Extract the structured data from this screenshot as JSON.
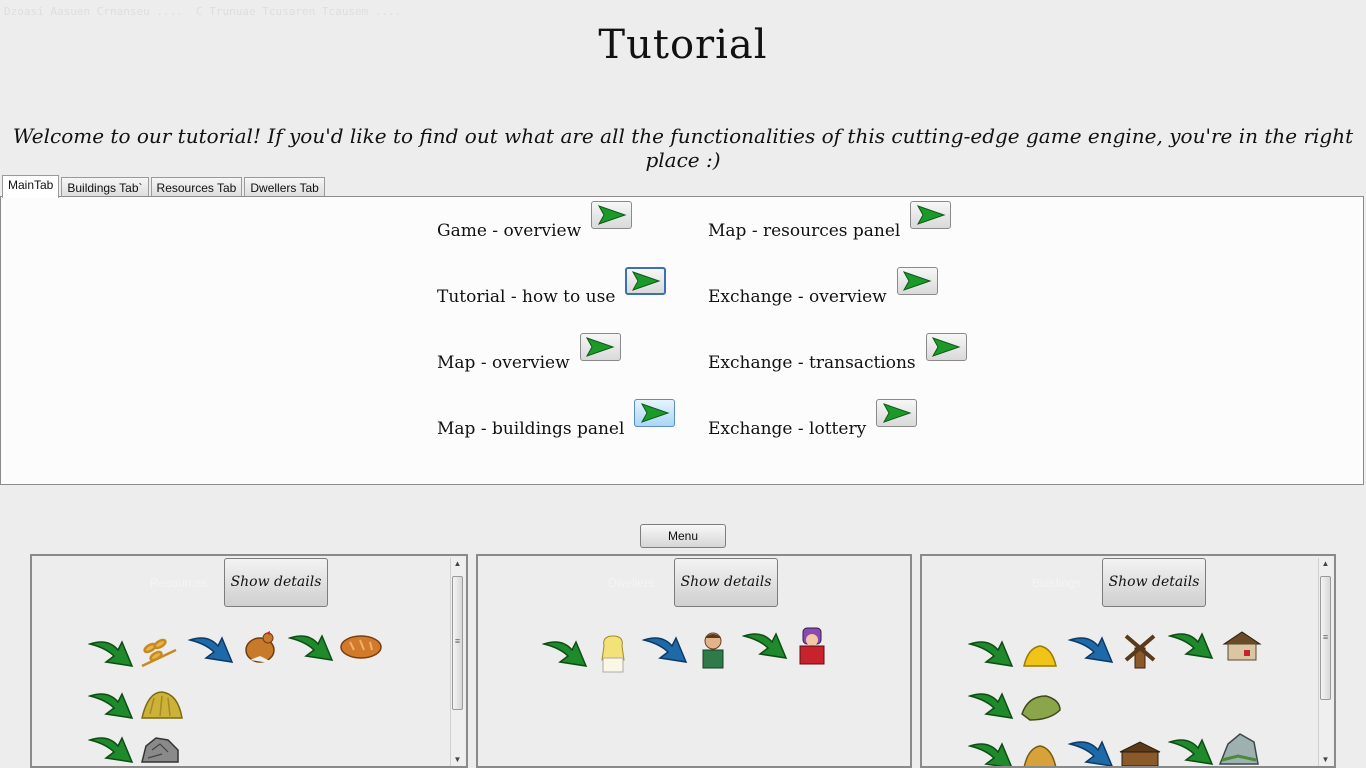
{
  "title": "Tutorial",
  "welcome": "Welcome to our tutorial! If you'd like to find out what are all the functionalities of this cutting-edge game engine, you're in the right place :)",
  "tabs": [
    "MainTab",
    "Buildings Tab`",
    "Resources Tab",
    "Dwellers Tab"
  ],
  "topics": {
    "col1": [
      "Game - overview",
      "Tutorial - how to use",
      "Map - overview",
      "Map - buildings panel"
    ],
    "col2": [
      "Map - resources panel",
      "Exchange - overview",
      "Exchange - transactions",
      "Exchange - lottery"
    ]
  },
  "menu_label": "Menu",
  "panels": [
    {
      "caption": "Resources",
      "details_label": "Show details"
    },
    {
      "caption": "Dwellers",
      "details_label": "Show details"
    },
    {
      "caption": "Buildings",
      "details_label": "Show details"
    }
  ],
  "colors": {
    "green_arrow": "#1f8a2c",
    "blue_arrow": "#1e6aa8",
    "play_green": "#1b9a2a"
  },
  "icons": {
    "play": "play-arrow-icon",
    "resources": [
      "wheat-icon",
      "chicken-icon",
      "bread-icon",
      "hay-icon",
      "stone-icon"
    ],
    "dwellers": [
      "farmer-woman-icon",
      "farmer-man-icon",
      "knight-icon"
    ],
    "buildings": [
      "gold-pile-icon",
      "windmill-icon",
      "house-icon",
      "grass-field-icon",
      "straw-hut-icon",
      "log-cabin-icon",
      "quarry-icon"
    ]
  }
}
